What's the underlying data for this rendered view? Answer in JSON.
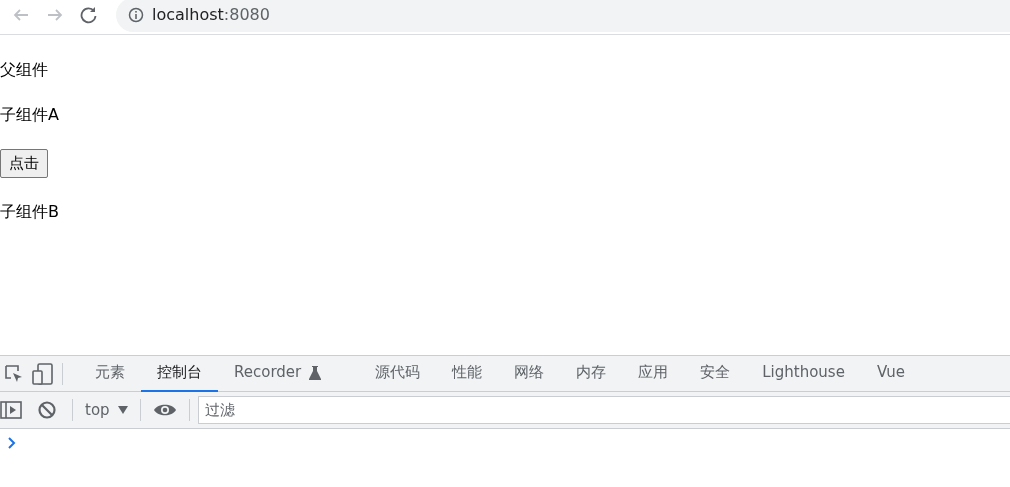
{
  "browser": {
    "host": "localhost",
    "port": ":8080"
  },
  "page": {
    "items": [
      {
        "kind": "text",
        "text": "父组件"
      },
      {
        "kind": "text",
        "text": "子组件A"
      },
      {
        "kind": "button",
        "text": "点击"
      },
      {
        "kind": "text",
        "text": "子组件B"
      }
    ]
  },
  "devtools": {
    "tabs": [
      {
        "label": "元素",
        "selected": false
      },
      {
        "label": "控制台",
        "selected": true
      },
      {
        "label": "Recorder",
        "selected": false,
        "experimental": true
      },
      {
        "label": "源代码",
        "selected": false
      },
      {
        "label": "性能",
        "selected": false
      },
      {
        "label": "网络",
        "selected": false
      },
      {
        "label": "内存",
        "selected": false
      },
      {
        "label": "应用",
        "selected": false
      },
      {
        "label": "安全",
        "selected": false
      },
      {
        "label": "Lighthouse",
        "selected": false
      },
      {
        "label": "Vue",
        "selected": false
      }
    ],
    "context": "top",
    "filter": {
      "placeholder": "过滤"
    }
  }
}
